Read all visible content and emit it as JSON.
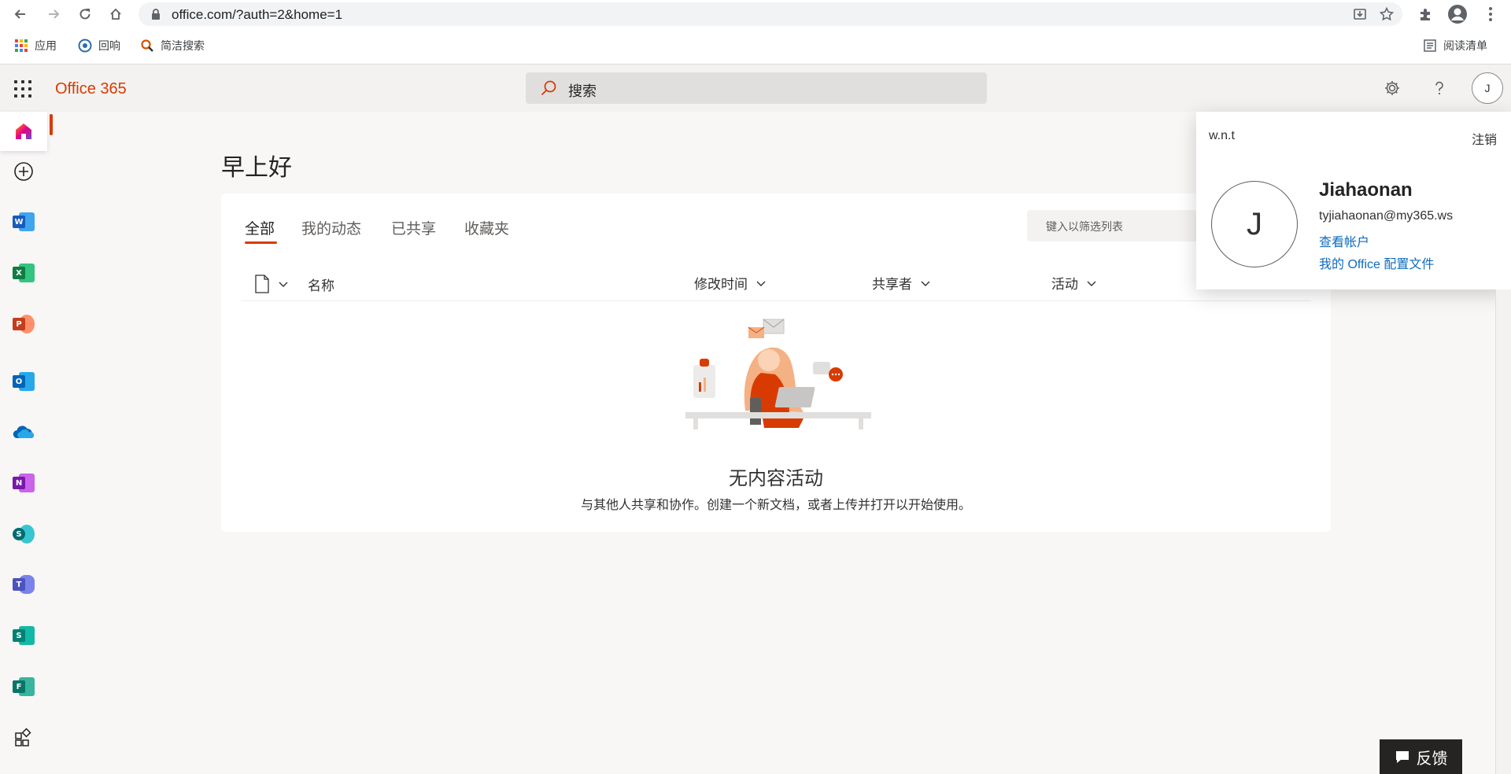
{
  "browser": {
    "url": "office.com/?auth=2&home=1",
    "bookmarks": [
      {
        "label": "应用",
        "icon": "apps-grid-icon"
      },
      {
        "label": "回响",
        "icon": "huixiang-icon"
      },
      {
        "label": "简洁搜索",
        "icon": "search-bookmark-icon"
      }
    ],
    "reading_list": "阅读清单"
  },
  "header": {
    "brand": "Office 365",
    "search_text": "搜索",
    "avatar_initial": "J"
  },
  "rail": {
    "items": [
      {
        "name": "home",
        "icon": "home-icon"
      },
      {
        "name": "create",
        "icon": "add-circle-icon"
      },
      {
        "name": "word",
        "icon": "word-icon",
        "letter": "W",
        "color": "#185abd"
      },
      {
        "name": "excel",
        "icon": "excel-icon",
        "letter": "X",
        "color": "#107c41"
      },
      {
        "name": "powerpoint",
        "icon": "powerpoint-icon",
        "letter": "P",
        "color": "#c43e1c"
      },
      {
        "name": "outlook",
        "icon": "outlook-icon",
        "letter": "O",
        "color": "#0364b8"
      },
      {
        "name": "onedrive",
        "icon": "onedrive-icon"
      },
      {
        "name": "onenote",
        "icon": "onenote-icon",
        "letter": "N",
        "color": "#7719aa"
      },
      {
        "name": "sharepoint",
        "icon": "sharepoint-icon",
        "letter": "S",
        "color": "#036c70"
      },
      {
        "name": "teams",
        "icon": "teams-icon",
        "letter": "T",
        "color": "#4b53bc"
      },
      {
        "name": "sway",
        "icon": "sway-icon",
        "letter": "S",
        "color": "#008272"
      },
      {
        "name": "forms",
        "icon": "forms-icon",
        "letter": "F",
        "color": "#077568"
      },
      {
        "name": "all-apps",
        "icon": "all-apps-icon"
      }
    ]
  },
  "main": {
    "greeting": "早上好",
    "tabs": [
      "全部",
      "我的动态",
      "已共享",
      "收藏夹"
    ],
    "filter_placeholder": "键入以筛选列表",
    "columns": {
      "name": "名称",
      "modified": "修改时间",
      "shared_by": "共享者",
      "activity": "活动"
    },
    "empty_title": "无内容活动",
    "empty_subtitle": "与其他人共享和协作。创建一个新文档，或者上传并打开以开始使用。"
  },
  "account": {
    "org": "w.n.t",
    "sign_out": "注销",
    "initial": "J",
    "name": "Jiahaonan",
    "email": "tyjiahaonan@my365.ws",
    "view_account": "查看帐户",
    "profile": "我的 Office 配置文件"
  },
  "feedback": "反馈",
  "colors": {
    "accent": "#d83b01",
    "link": "#0f6cbd"
  }
}
